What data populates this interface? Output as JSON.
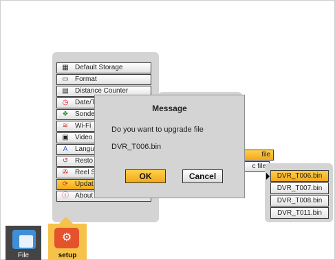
{
  "menu": {
    "items": [
      {
        "label": "Default Storage",
        "icon": "storage-icon",
        "glyph": "▦"
      },
      {
        "label": "Format",
        "icon": "format-icon",
        "glyph": "▭"
      },
      {
        "label": "Distance Counter",
        "icon": "counter-icon",
        "glyph": "▤"
      },
      {
        "label": "Date/T",
        "icon": "clock-icon",
        "glyph": "◷"
      },
      {
        "label": "Sonde",
        "icon": "sonde-icon",
        "glyph": "❖"
      },
      {
        "label": "Wi-Fi",
        "icon": "wifi-icon",
        "glyph": "≋"
      },
      {
        "label": "Video",
        "icon": "video-icon",
        "glyph": "▣"
      },
      {
        "label": "Langu",
        "icon": "language-icon",
        "glyph": "A"
      },
      {
        "label": "Resto",
        "icon": "restore-icon",
        "glyph": "↺"
      },
      {
        "label": "Reel S",
        "icon": "reel-icon",
        "glyph": "✇"
      },
      {
        "label": "Updat",
        "icon": "update-icon",
        "glyph": "⟳"
      },
      {
        "label": "About",
        "icon": "info-icon",
        "glyph": "ⓘ"
      }
    ]
  },
  "submenu": {
    "items": [
      {
        "label": "file"
      },
      {
        "label": "c file"
      }
    ]
  },
  "files": {
    "items": [
      {
        "label": "DVR_T006.bin"
      },
      {
        "label": "DVR_T007.bin"
      },
      {
        "label": "DVR_T008.bin"
      },
      {
        "label": "DVR_T011.bin"
      }
    ]
  },
  "dialog": {
    "title": "Message",
    "line1": "Do you want to upgrade file",
    "line2": "DVR_T006.bin",
    "ok_label": "OK",
    "cancel_label": "Cancel"
  },
  "bottom_bar": {
    "file_label": "File",
    "setup_label": "setup",
    "setup_glyph": "⚙"
  },
  "colors": {
    "accent": "#f3a81a",
    "panel": "#d4d4d4"
  }
}
